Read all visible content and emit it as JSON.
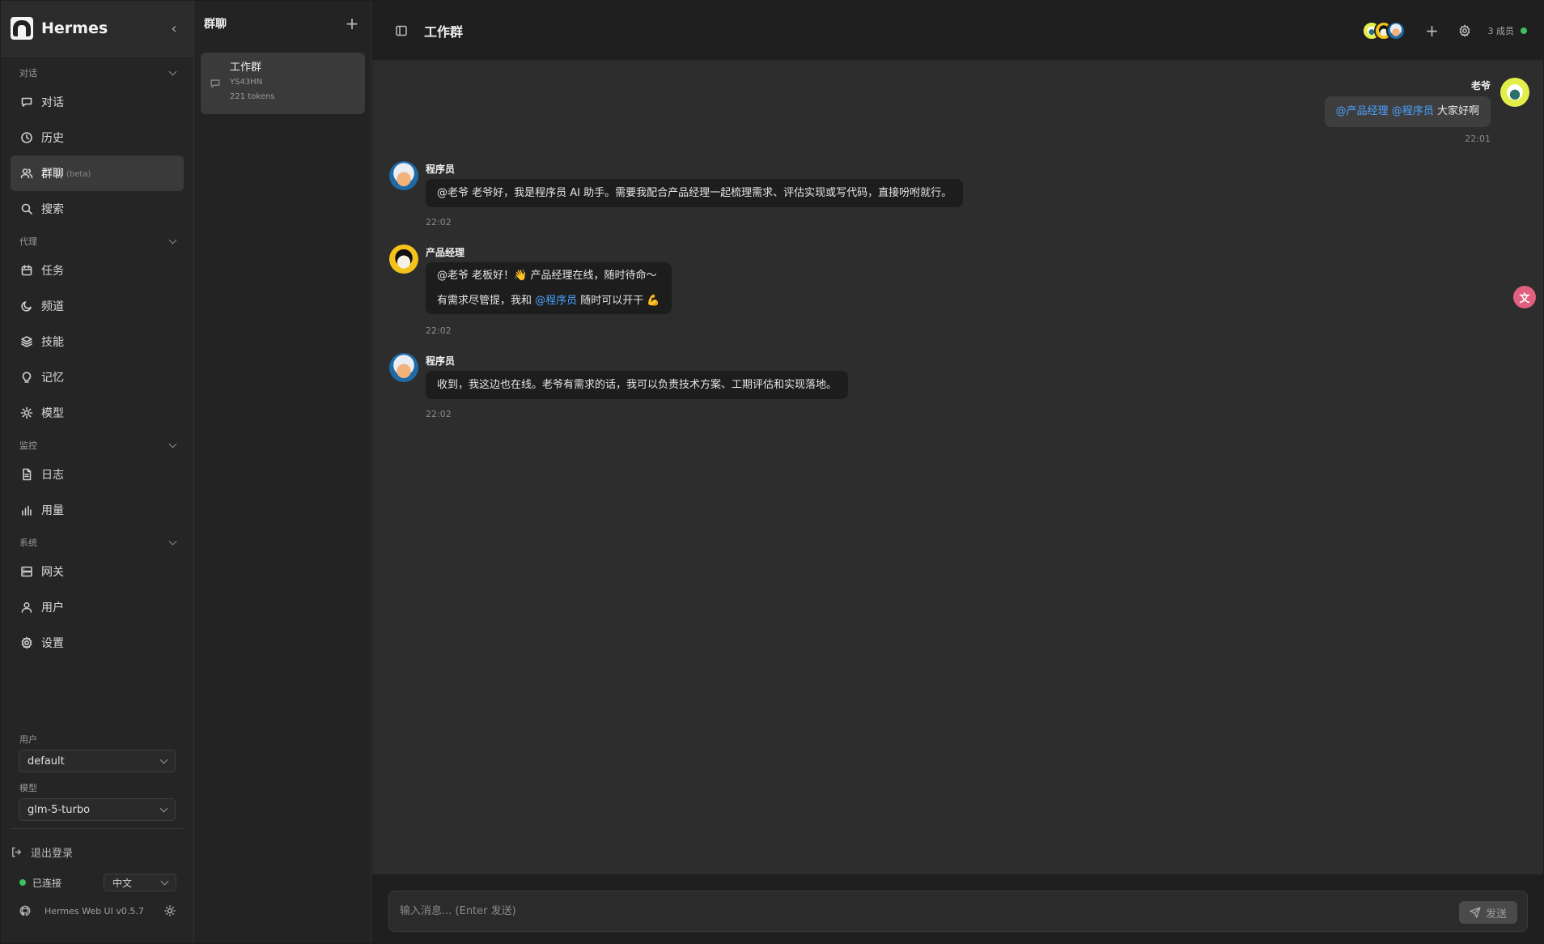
{
  "app": {
    "name": "Hermes"
  },
  "sidebar": {
    "sections": [
      {
        "label": "对话",
        "items": [
          {
            "label": "对话",
            "icon": "chat-icon"
          },
          {
            "label": "历史",
            "icon": "clock-icon"
          },
          {
            "label": "群聊",
            "icon": "users-icon",
            "badge": "(beta)",
            "active": true
          },
          {
            "label": "搜索",
            "icon": "search-icon"
          }
        ]
      },
      {
        "label": "代理",
        "items": [
          {
            "label": "任务",
            "icon": "calendar-icon"
          },
          {
            "label": "频道",
            "icon": "moon-icon"
          },
          {
            "label": "技能",
            "icon": "layers-icon"
          },
          {
            "label": "记忆",
            "icon": "bulb-icon"
          },
          {
            "label": "模型",
            "icon": "sun-icon"
          }
        ]
      },
      {
        "label": "监控",
        "items": [
          {
            "label": "日志",
            "icon": "file-icon"
          },
          {
            "label": "用量",
            "icon": "bar-chart-icon"
          }
        ]
      },
      {
        "label": "系统",
        "items": [
          {
            "label": "网关",
            "icon": "server-icon"
          },
          {
            "label": "用户",
            "icon": "user-icon"
          },
          {
            "label": "设置",
            "icon": "gear-icon"
          }
        ]
      }
    ],
    "user_label": "用户",
    "user_value": "default",
    "model_label": "模型",
    "model_value": "glm-5-turbo",
    "logout": "退出登录",
    "status": "已连接",
    "language": "中文",
    "version": "Hermes Web UI v0.5.7",
    "status_color": "#3fbf5f"
  },
  "list_panel": {
    "title": "群聊",
    "conversations": [
      {
        "name": "工作群",
        "id": "YS43HN",
        "tokens": "221 tokens"
      }
    ]
  },
  "chat": {
    "title": "工作群",
    "members": "3 成员",
    "mention_color": "#4aa3ff",
    "messages": [
      {
        "sender": "老爷",
        "mine": true,
        "mentions": [
          "@产品经理",
          "@程序员"
        ],
        "text": "大家好啊",
        "time": "22:01"
      },
      {
        "sender": "程序员",
        "text": "@老爷 老爷好，我是程序员 AI 助手。需要我配合产品经理一起梳理需求、评估实现或写代码，直接吩咐就行。",
        "time": "22:02"
      },
      {
        "sender": "产品经理",
        "line1": "@老爷 老板好！👋 产品经理在线，随时待命～",
        "line2_pre": "有需求尽管提，我和 ",
        "line2_mention": "@程序员",
        "line2_post": " 随时可以开干 💪",
        "time": "22:02"
      },
      {
        "sender": "程序员",
        "text": "收到，我这边也在线。老爷有需求的话，我可以负责技术方案、工期评估和实现落地。",
        "time": "22:02"
      }
    ],
    "input_placeholder": "输入消息... (Enter 发送)",
    "send_label": "发送"
  }
}
